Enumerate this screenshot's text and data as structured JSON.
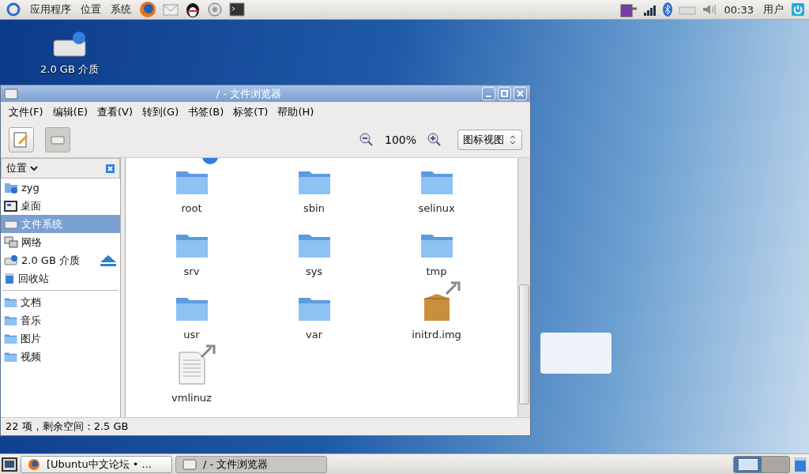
{
  "top_panel": {
    "menus": [
      "应用程序",
      "位置",
      "系统"
    ],
    "clock": "00:33",
    "user": "用户"
  },
  "desktop_icons": [
    {
      "label": "2.0 GB 介质"
    }
  ],
  "window": {
    "title": "/ - 文件浏览器",
    "menu": [
      "文件(F)",
      "编辑(E)",
      "查看(V)",
      "转到(G)",
      "书签(B)",
      "标签(T)",
      "帮助(H)"
    ],
    "toolbar": {
      "zoom": "100%",
      "view": "图标视图"
    },
    "sidebar": {
      "header": "位置",
      "places": [
        {
          "label": "zyg",
          "kind": "home",
          "selected": false,
          "eject": false
        },
        {
          "label": "桌面",
          "kind": "desktop",
          "selected": false,
          "eject": false
        },
        {
          "label": "文件系统",
          "kind": "drive",
          "selected": true,
          "eject": false
        },
        {
          "label": "网络",
          "kind": "network",
          "selected": false,
          "eject": false
        },
        {
          "label": "2.0 GB 介质",
          "kind": "usb",
          "selected": false,
          "eject": true
        },
        {
          "label": "回收站",
          "kind": "trash",
          "selected": false,
          "eject": false
        }
      ],
      "bookmarks": [
        {
          "label": "文档",
          "kind": "folder",
          "selected": false,
          "eject": false
        },
        {
          "label": "音乐",
          "kind": "folder",
          "selected": false,
          "eject": false
        },
        {
          "label": "图片",
          "kind": "folder",
          "selected": false,
          "eject": false
        },
        {
          "label": "视频",
          "kind": "folder",
          "selected": false,
          "eject": false
        }
      ]
    },
    "files": [
      {
        "name": "root",
        "kind": "folder",
        "link": false,
        "emblem": true
      },
      {
        "name": "sbin",
        "kind": "folder",
        "link": false,
        "emblem": false
      },
      {
        "name": "selinux",
        "kind": "folder",
        "link": false,
        "emblem": false
      },
      {
        "name": "srv",
        "kind": "folder",
        "link": false,
        "emblem": false
      },
      {
        "name": "sys",
        "kind": "folder",
        "link": false,
        "emblem": false
      },
      {
        "name": "tmp",
        "kind": "folder",
        "link": false,
        "emblem": false
      },
      {
        "name": "usr",
        "kind": "folder",
        "link": false,
        "emblem": false
      },
      {
        "name": "var",
        "kind": "folder",
        "link": false,
        "emblem": false
      },
      {
        "name": "initrd.img",
        "kind": "archive",
        "link": true,
        "emblem": false
      },
      {
        "name": "vmlinuz",
        "kind": "text",
        "link": true,
        "emblem": false
      }
    ],
    "status": "22 项，剩余空间：2.5 GB"
  },
  "bottom_panel": {
    "tasks": [
      {
        "label": "[Ubuntu中文论坛 • ...",
        "kind": "browser",
        "selected": false
      },
      {
        "label": "/ - 文件浏览器",
        "kind": "files",
        "selected": true
      }
    ],
    "workspaces": [
      {
        "selected": true
      },
      {
        "selected": false
      }
    ]
  }
}
